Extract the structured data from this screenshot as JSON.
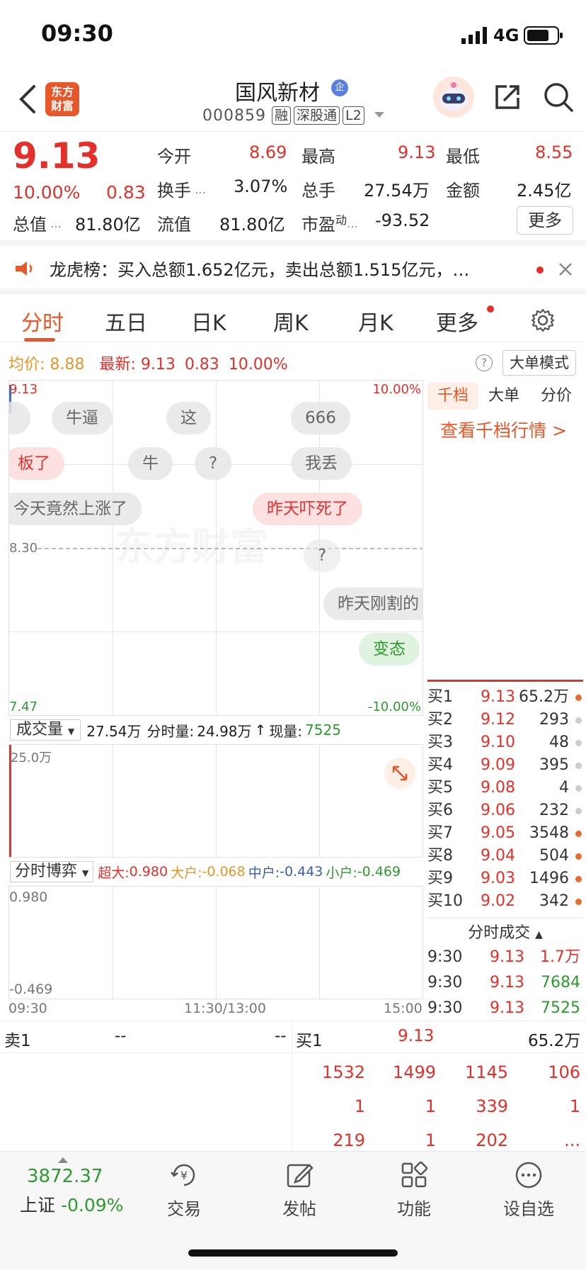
{
  "status_bar": {
    "time": "09:30",
    "network": "4G"
  },
  "header": {
    "app_logo_text": "东方财富",
    "stock_name": "国风新材",
    "enterprise_badge": "企",
    "stock_code": "000859",
    "tags": [
      "融",
      "深股通",
      "L2"
    ]
  },
  "quote": {
    "price": "9.13",
    "change_pct": "10.00%",
    "change": "0.83",
    "open_label": "今开",
    "open": "8.69",
    "high_label": "最高",
    "high": "9.13",
    "low_label": "最低",
    "low": "8.55",
    "turnover_label": "换手",
    "turnover": "3.07%",
    "volume_label": "总手",
    "volume": "27.54万",
    "amount_label": "金额",
    "amount": "2.45亿",
    "mktcap_label": "总值",
    "mktcap": "81.80亿",
    "float_label": "流值",
    "float": "81.80亿",
    "pe_label": "市盈",
    "pe_sup": "动",
    "pe": "-93.52",
    "more_button": "更多"
  },
  "news_ticker": {
    "text": "龙虎榜：买入总额1.652亿元，卖出总额1.515亿元，…"
  },
  "chart_tabs": [
    "分时",
    "五日",
    "日K",
    "周K",
    "月K",
    "更多"
  ],
  "avg_bar": {
    "avg_label": "均价:",
    "avg": "8.88",
    "latest_label": "最新:",
    "latest": "9.13",
    "latest_change": "0.83",
    "latest_pct": "10.00%",
    "big_order_mode": "大单模式"
  },
  "main_chart": {
    "y_top": "9.13",
    "y_top_pct": "10.00%",
    "y_mid": "8.30",
    "y_bottom": "7.47",
    "y_bottom_pct": "-10.00%",
    "watermark": "东方财富"
  },
  "danmaku": [
    {
      "text": "牛逼"
    },
    {
      "text": "这"
    },
    {
      "text": "666"
    },
    {
      "text": "板了"
    },
    {
      "text": "牛"
    },
    {
      "text": "?"
    },
    {
      "text": "我丢"
    },
    {
      "text": "今天竟然上涨了"
    },
    {
      "text": "昨天吓死了"
    },
    {
      "text": "?"
    },
    {
      "text": "昨天刚割的"
    },
    {
      "text": "变态"
    }
  ],
  "volume_panel": {
    "selector": "成交量",
    "total": "27.54万",
    "minute_label": "分时量:",
    "minute": "24.98万",
    "current_label": "现量:",
    "current": "7525",
    "y_max": "25.0万"
  },
  "game_panel": {
    "selector": "分时博弈",
    "super_label": "超大:",
    "super": "0.980",
    "big_label": "大户:",
    "big": "-0.068",
    "mid_label": "中户:",
    "mid": "-0.443",
    "small_label": "小户:",
    "small": "-0.469",
    "y_max": "0.980",
    "y_min": "-0.469"
  },
  "time_axis": {
    "start": "09:30",
    "mid": "11:30/13:00",
    "end": "15:00"
  },
  "right_panel": {
    "tabs": [
      "千档",
      "大单",
      "分价"
    ],
    "link": "查看千档行情 >",
    "bids": [
      {
        "label": "买1",
        "price": "9.13",
        "vol": "65.2万",
        "dot": "#e86a2e"
      },
      {
        "label": "买2",
        "price": "9.12",
        "vol": "293",
        "dot": "#cccccc"
      },
      {
        "label": "买3",
        "price": "9.10",
        "vol": "48",
        "dot": "#cccccc"
      },
      {
        "label": "买4",
        "price": "9.09",
        "vol": "395",
        "dot": "#cccccc"
      },
      {
        "label": "买5",
        "price": "9.08",
        "vol": "4",
        "dot": "#cccccc"
      },
      {
        "label": "买6",
        "price": "9.06",
        "vol": "232",
        "dot": "#cccccc"
      },
      {
        "label": "买7",
        "price": "9.05",
        "vol": "3548",
        "dot": "#e86a2e"
      },
      {
        "label": "买8",
        "price": "9.04",
        "vol": "504",
        "dot": "#e86a2e"
      },
      {
        "label": "买9",
        "price": "9.03",
        "vol": "1496",
        "dot": "#e86a2e"
      },
      {
        "label": "买10",
        "price": "9.02",
        "vol": "342",
        "dot": "#e86a2e"
      }
    ],
    "trades_title": "分时成交",
    "trades": [
      {
        "time": "9:30",
        "price": "9.13",
        "vol": "1.7万",
        "color": "#e2312a"
      },
      {
        "time": "9:30",
        "price": "9.13",
        "vol": "7684",
        "color": "#2f9a2f"
      },
      {
        "time": "9:30",
        "price": "9.13",
        "vol": "7525",
        "color": "#2f9a2f"
      }
    ]
  },
  "bottom_book": {
    "sell1_label": "卖1",
    "sell1_price": "--",
    "sell1_vol": "--",
    "buy1_label": "买1",
    "buy1_price": "9.13",
    "buy1_vol": "65.2万",
    "rows": [
      [
        "1532",
        "1499",
        "1145",
        "106"
      ],
      [
        "1",
        "1",
        "339",
        "1"
      ],
      [
        "219",
        "1",
        "202",
        "..."
      ]
    ]
  },
  "bottom_nav": {
    "index_value": "3872.37",
    "index_name": "上证",
    "index_change": "-0.09%",
    "items": [
      "交易",
      "发帖",
      "功能",
      "设自选"
    ]
  },
  "colors": {
    "up": "#e2312a",
    "down": "#2f9a2f",
    "accent": "#e8572a"
  }
}
